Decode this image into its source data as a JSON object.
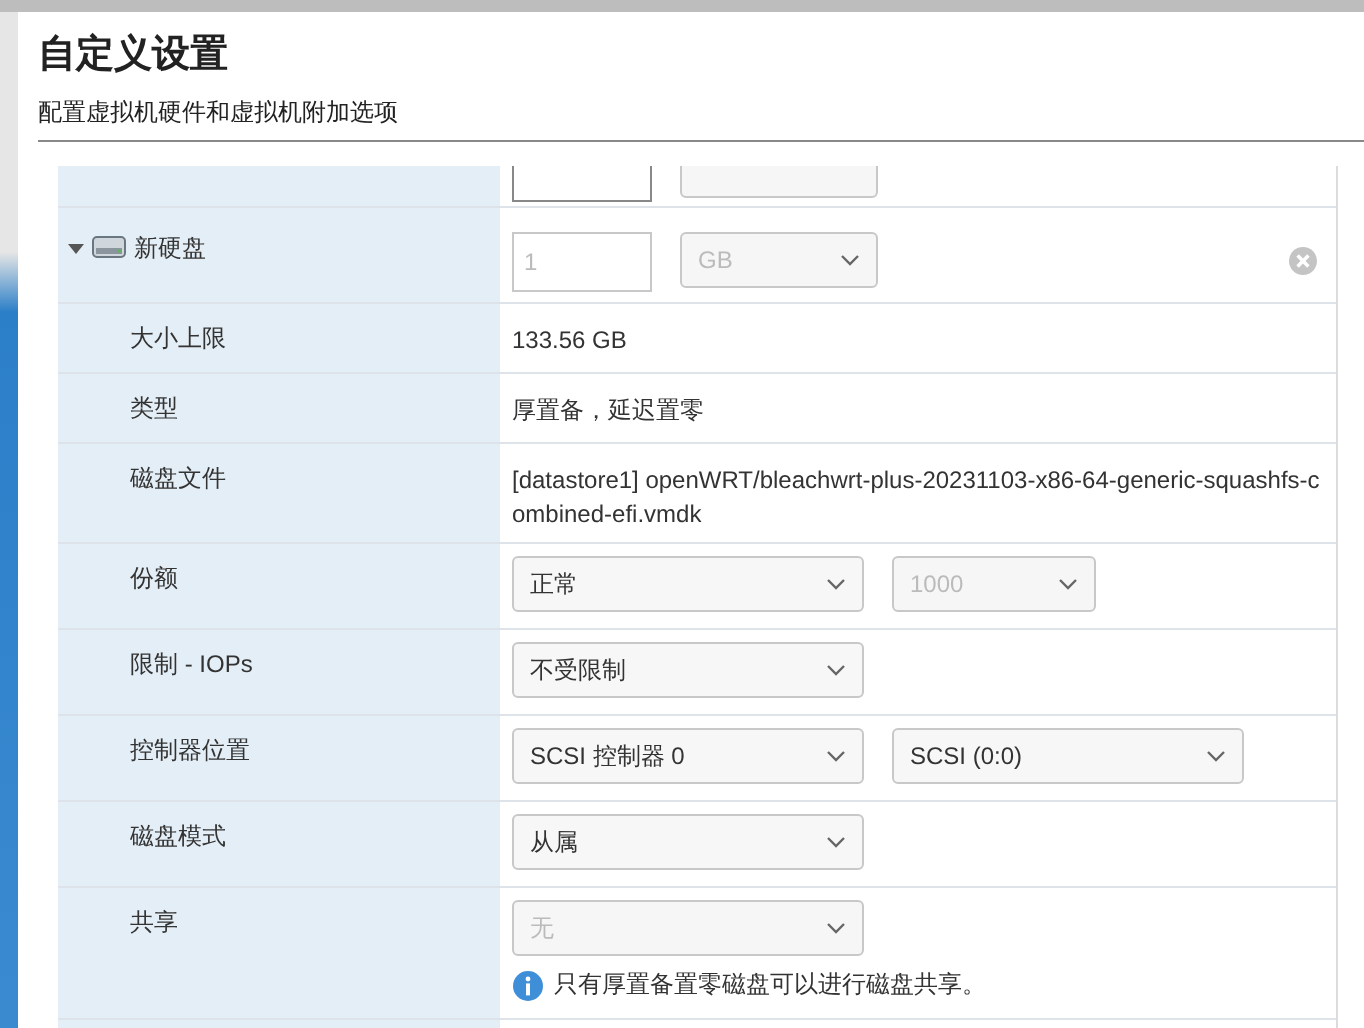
{
  "dialog": {
    "title": "自定义设置",
    "subtitle": "配置虚拟机硬件和虚拟机附加选项"
  },
  "disk": {
    "label": "新硬盘",
    "expanded": true,
    "size": {
      "value": "1",
      "disabled": true
    },
    "unit": {
      "value": "GB",
      "disabled": true
    }
  },
  "rows": [
    {
      "label": "大小上限",
      "kind": "text",
      "text": "133.56 GB"
    },
    {
      "label": "类型",
      "kind": "text",
      "text": "厚置备，延迟置零"
    },
    {
      "label": "磁盘文件",
      "kind": "text",
      "text": "[datastore1] openWRT/bleachwrt-plus-20231103-x86-64-generic-squashfs-combined-efi.vmdk"
    },
    {
      "label": "份额",
      "kind": "selects",
      "selects": [
        {
          "value": "正常",
          "disabled": false
        },
        {
          "value": "1000",
          "disabled": true
        }
      ]
    },
    {
      "label": "限制 - IOPs",
      "kind": "selects",
      "selects": [
        {
          "value": "不受限制",
          "disabled": false
        }
      ]
    },
    {
      "label": "控制器位置",
      "kind": "selects",
      "selects": [
        {
          "value": "SCSI 控制器 0",
          "disabled": false
        },
        {
          "value": "SCSI (0:0)",
          "disabled": false
        }
      ]
    },
    {
      "label": "磁盘模式",
      "kind": "selects",
      "selects": [
        {
          "value": "从属",
          "disabled": false
        }
      ]
    },
    {
      "label": "共享",
      "kind": "selects",
      "selects": [
        {
          "value": "无",
          "disabled": true
        }
      ],
      "note": "只有厚置备置零磁盘可以进行磁盘共享。"
    }
  ]
}
